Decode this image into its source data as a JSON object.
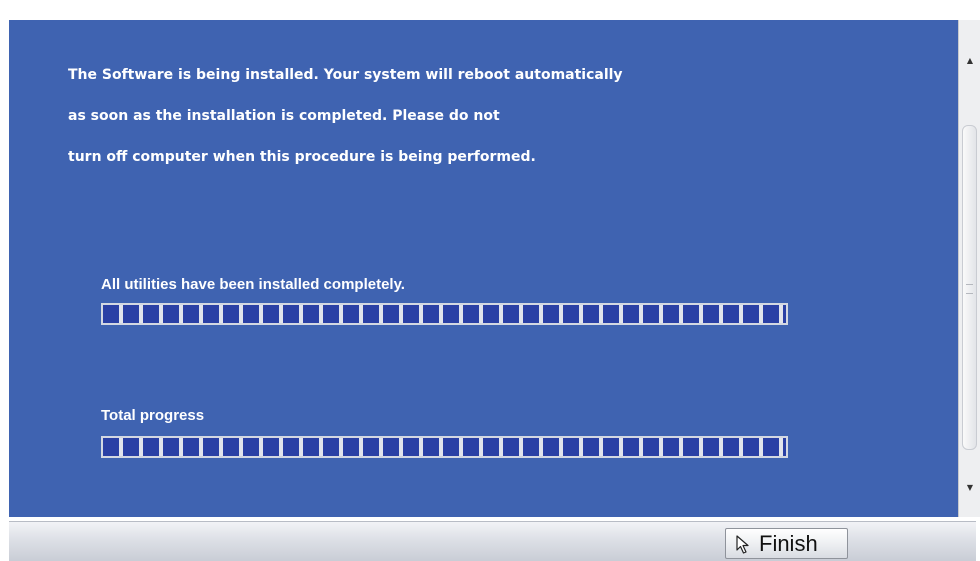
{
  "installer": {
    "message_lines": [
      "The Software is being installed. Your system will reboot automatically",
      "as soon as the installation is completed. Please do not",
      "turn off computer when this procedure is being performed."
    ],
    "utilities": {
      "label": "All utilities have been installed completely.",
      "progress_fraction": 1.0
    },
    "total": {
      "label": "Total progress",
      "progress_fraction": 1.0
    }
  },
  "footer": {
    "finish_label": "Finish"
  },
  "icons": {
    "cursor": "arrow-cursor-icon",
    "scroll_up": "scroll-up-arrow-icon",
    "scroll_down": "scroll-down-arrow-icon"
  },
  "colors": {
    "panel_background": "#3f63b1",
    "progress_segment": "#2a40a5",
    "text": "#ffffff"
  }
}
